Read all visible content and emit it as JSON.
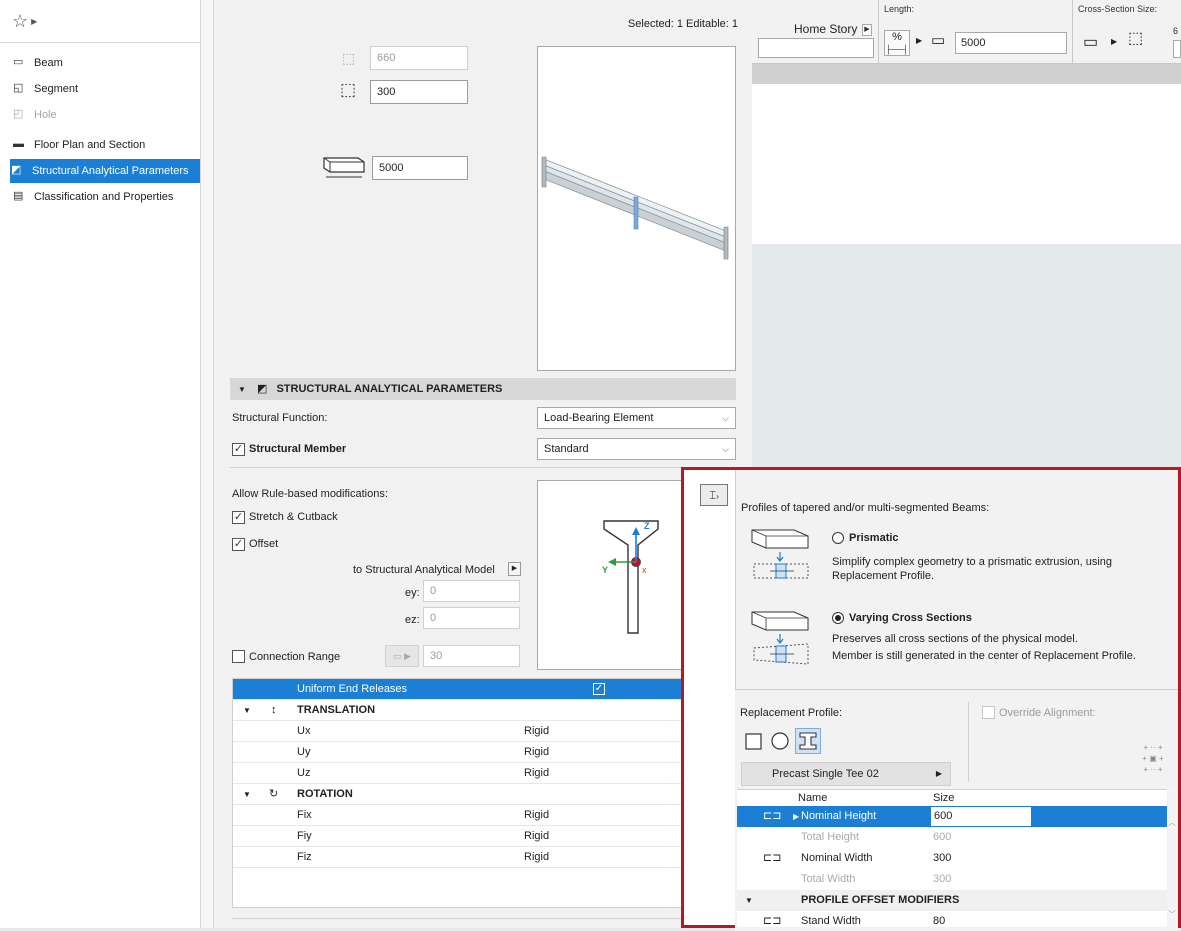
{
  "toolbar": {
    "home_story": "Home Story",
    "length_label": "Length:",
    "length_value": "5000",
    "cross_section_label": "Cross-Section Size:",
    "cross_section_value_partial": "6",
    "percent_label": "%"
  },
  "nav": {
    "items": [
      {
        "label": "Beam",
        "icon": "beam-icon",
        "state": "normal"
      },
      {
        "label": "Segment",
        "icon": "segment-icon",
        "state": "normal"
      },
      {
        "label": "Hole",
        "icon": "hole-icon",
        "state": "disabled"
      },
      {
        "label": "Floor Plan and Section",
        "icon": "floor-plan-icon",
        "state": "normal"
      },
      {
        "label": "Structural Analytical Parameters",
        "icon": "structural-icon",
        "state": "selected"
      },
      {
        "label": "Classification and Properties",
        "icon": "classification-icon",
        "state": "normal"
      }
    ]
  },
  "header": {
    "selected_info": "Selected: 1 Editable: 1"
  },
  "geometry": {
    "height_value": "660",
    "width_value": "300",
    "length_value": "5000"
  },
  "section": {
    "title": "STRUCTURAL ANALYTICAL PARAMETERS",
    "structural_function_label": "Structural Function:",
    "structural_function_value": "Load-Bearing Element",
    "structural_member_label": "Structural Member",
    "structural_member_value": "Standard",
    "structural_member_checked": true,
    "allow_rule_label": "Allow Rule-based modifications:",
    "stretch_label": "Stretch & Cutback",
    "stretch_checked": true,
    "offset_label": "Offset",
    "offset_checked": true,
    "to_model_label": "to Structural Analytical Model",
    "ey_label": "ey:",
    "ey_value": "0",
    "ez_label": "ez:",
    "ez_value": "0",
    "connection_range_label": "Connection Range",
    "connection_range_value": "30",
    "connection_range_checked": false,
    "axes": {
      "z": "Z",
      "y": "Y",
      "x": "x"
    }
  },
  "releases": {
    "uniform_label": "Uniform End Releases",
    "translation_label": "TRANSLATION",
    "rotation_label": "ROTATION",
    "translation_rows": [
      {
        "name": "Ux",
        "value": "Rigid"
      },
      {
        "name": "Uy",
        "value": "Rigid"
      },
      {
        "name": "Uz",
        "value": "Rigid"
      }
    ],
    "rotation_rows": [
      {
        "name": "Fix",
        "value": "Rigid"
      },
      {
        "name": "Fiy",
        "value": "Rigid"
      },
      {
        "name": "Fiz",
        "value": "Rigid"
      }
    ]
  },
  "popup": {
    "heading": "Profiles of tapered and/or multi-segmented Beams:",
    "prismatic_title": "Prismatic",
    "prismatic_desc_1": "Simplify complex geometry to a prismatic extrusion, using",
    "prismatic_desc_2": "Replacement Profile.",
    "varying_title": "Varying Cross Sections",
    "varying_desc_1": "Preserves all cross sections of the physical model.",
    "varying_desc_2": "Member is still generated in the center of Replacement Profile.",
    "selected_option": "Varying Cross Sections",
    "replacement_label": "Replacement Profile:",
    "override_label": "Override Alignment:",
    "profile_name": "Precast Single Tee 02",
    "col_name": "Name",
    "col_size": "Size",
    "rows": [
      {
        "name": "Nominal Height",
        "size": "600",
        "kind": "selected"
      },
      {
        "name": "Total Height",
        "size": "600",
        "kind": "dim"
      },
      {
        "name": "Nominal Width",
        "size": "300",
        "kind": "normal"
      },
      {
        "name": "Total Width",
        "size": "300",
        "kind": "dim"
      }
    ],
    "modifiers_label": "PROFILE OFFSET MODIFIERS",
    "stand_width_label": "Stand Width",
    "stand_width_value": "80"
  },
  "colors": {
    "selection": "#1b7fd6",
    "highlight_frame": "#b11b28",
    "axis_z": "#1b7fd6",
    "axis_y": "#2e9e3a",
    "axis_x": "#d63a2a"
  }
}
